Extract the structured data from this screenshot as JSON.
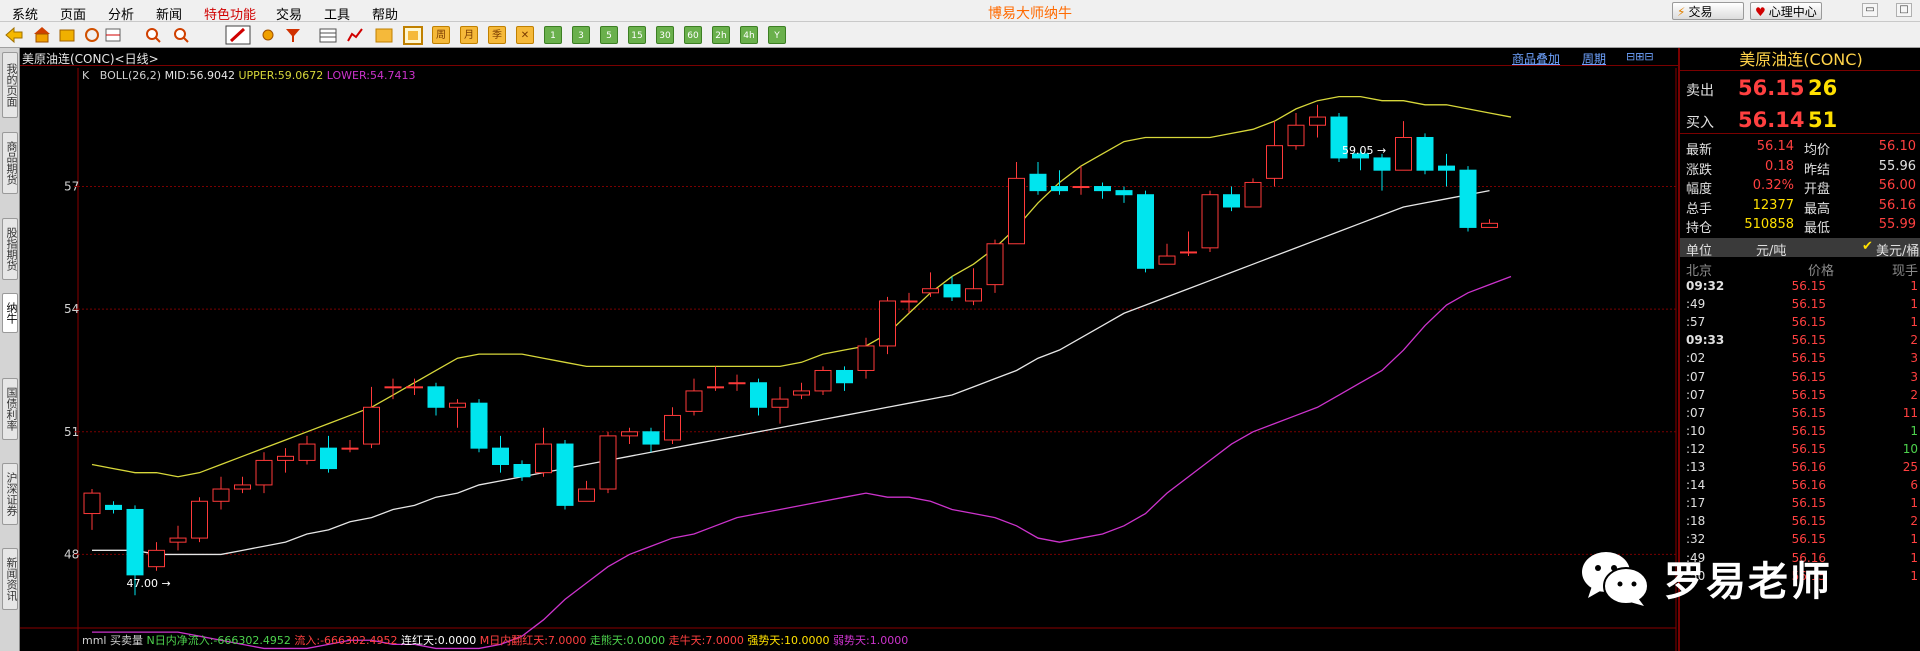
{
  "menu": [
    "系统",
    "页面",
    "分析",
    "新闻",
    "特色功能",
    "交易",
    "工具",
    "帮助"
  ],
  "app_title": "博易大师纳牛",
  "top_buttons": {
    "trade": "交易",
    "center": "心理中心"
  },
  "toolbar_labels": [
    "周",
    "月",
    "季",
    "1",
    "3",
    "5",
    "15",
    "30",
    "60",
    "2h",
    "4h",
    "Y"
  ],
  "left_tabs": [
    "我的页面",
    "商品期货",
    "股指期货",
    "纳牛",
    "国债利率",
    "沪深证券",
    "新闻资讯"
  ],
  "chart_header": {
    "title": "美原油连(CONC)<日线>",
    "link_add": "商品叠加",
    "link_period": "周期"
  },
  "indicator": {
    "prefix": "K",
    "name": "BOLL(26,2)",
    "mid": "MID:56.9042",
    "upper": "UPPER:59.0672",
    "lower": "LOWER:54.7413",
    "colors": {
      "mid": "#e6e6e6",
      "upper": "#d7d73a",
      "lower": "#cc33cc"
    }
  },
  "chart_data": {
    "type": "candlestick",
    "y_ticks": [
      48,
      51,
      54,
      57
    ],
    "ylim": [
      46.2,
      59.9
    ],
    "annotations": [
      {
        "text": "59.05",
        "index": 60
      },
      {
        "text": "47.00",
        "index": 3
      }
    ],
    "candles": [
      [
        49.0,
        49.5,
        49.6,
        48.6
      ],
      [
        49.2,
        49.1,
        49.3,
        49.0
      ],
      [
        49.1,
        47.5,
        49.2,
        47.0
      ],
      [
        47.7,
        48.1,
        48.3,
        47.6
      ],
      [
        48.3,
        48.4,
        48.7,
        48.1
      ],
      [
        48.4,
        49.3,
        49.4,
        48.3
      ],
      [
        49.3,
        49.6,
        49.9,
        49.1
      ],
      [
        49.6,
        49.7,
        49.9,
        49.5
      ],
      [
        49.7,
        50.3,
        50.5,
        49.5
      ],
      [
        50.3,
        50.4,
        50.6,
        50.0
      ],
      [
        50.3,
        50.7,
        50.9,
        50.2
      ],
      [
        50.6,
        50.1,
        50.9,
        50.0
      ],
      [
        50.6,
        50.6,
        50.8,
        50.5
      ],
      [
        50.7,
        51.6,
        52.1,
        50.6
      ],
      [
        52.1,
        52.1,
        52.3,
        51.8
      ],
      [
        52.1,
        52.1,
        52.3,
        51.9
      ],
      [
        52.1,
        51.6,
        52.2,
        51.4
      ],
      [
        51.6,
        51.7,
        51.8,
        51.1
      ],
      [
        51.7,
        50.6,
        51.8,
        50.5
      ],
      [
        50.6,
        50.2,
        50.9,
        50.0
      ],
      [
        50.2,
        49.9,
        50.3,
        49.8
      ],
      [
        50.0,
        50.7,
        51.1,
        49.9
      ],
      [
        50.7,
        49.2,
        50.8,
        49.1
      ],
      [
        49.3,
        49.6,
        49.8,
        49.3
      ],
      [
        49.6,
        50.9,
        51.0,
        49.5
      ],
      [
        50.9,
        51.0,
        51.1,
        50.7
      ],
      [
        51.0,
        50.7,
        51.1,
        50.5
      ],
      [
        50.8,
        51.4,
        51.6,
        50.7
      ],
      [
        51.5,
        52.0,
        52.3,
        51.4
      ],
      [
        52.1,
        52.1,
        52.6,
        52.0
      ],
      [
        52.2,
        52.2,
        52.4,
        52.0
      ],
      [
        52.2,
        51.6,
        52.3,
        51.4
      ],
      [
        51.6,
        51.8,
        52.1,
        51.2
      ],
      [
        51.9,
        52.0,
        52.2,
        51.8
      ],
      [
        52.0,
        52.5,
        52.6,
        51.9
      ],
      [
        52.5,
        52.2,
        52.6,
        52.0
      ],
      [
        52.5,
        53.1,
        53.3,
        52.3
      ],
      [
        53.1,
        54.2,
        54.3,
        52.9
      ],
      [
        54.2,
        54.2,
        54.4,
        53.9
      ],
      [
        54.4,
        54.5,
        54.9,
        54.3
      ],
      [
        54.6,
        54.3,
        54.8,
        54.2
      ],
      [
        54.2,
        54.5,
        55.0,
        54.1
      ],
      [
        54.6,
        55.6,
        55.7,
        54.4
      ],
      [
        55.6,
        57.2,
        57.6,
        55.6
      ],
      [
        57.3,
        56.9,
        57.6,
        56.8
      ],
      [
        57.0,
        56.9,
        57.4,
        56.8
      ],
      [
        57.0,
        57.0,
        57.5,
        56.8
      ],
      [
        57.0,
        56.9,
        57.1,
        56.7
      ],
      [
        56.9,
        56.8,
        57.0,
        56.6
      ],
      [
        56.8,
        55.0,
        56.9,
        54.9
      ],
      [
        55.1,
        55.3,
        55.6,
        55.1
      ],
      [
        55.4,
        55.4,
        55.9,
        55.3
      ],
      [
        55.5,
        56.8,
        56.9,
        55.4
      ],
      [
        56.8,
        56.5,
        57.0,
        56.4
      ],
      [
        56.5,
        57.1,
        57.2,
        56.5
      ],
      [
        57.2,
        58.0,
        58.6,
        57.0
      ],
      [
        58.0,
        58.5,
        58.8,
        57.9
      ],
      [
        58.5,
        58.7,
        59.0,
        58.2
      ],
      [
        58.7,
        57.7,
        58.8,
        57.6
      ],
      [
        57.8,
        57.7,
        57.9,
        57.4
      ],
      [
        57.7,
        57.4,
        57.8,
        56.9
      ],
      [
        57.4,
        58.2,
        58.6,
        57.4
      ],
      [
        58.2,
        57.4,
        58.3,
        57.3
      ],
      [
        57.5,
        57.4,
        57.8,
        57.0
      ],
      [
        57.4,
        56.0,
        57.5,
        55.9
      ],
      [
        56.0,
        56.1,
        56.2,
        56.0
      ]
    ],
    "series": [
      {
        "name": "UPPER",
        "values": [
          50.2,
          50.1,
          50.0,
          50.0,
          49.9,
          50.0,
          50.2,
          50.4,
          50.6,
          50.8,
          51.0,
          51.2,
          51.4,
          51.6,
          51.9,
          52.2,
          52.5,
          52.8,
          52.9,
          52.9,
          52.9,
          52.8,
          52.7,
          52.6,
          52.6,
          52.6,
          52.6,
          52.6,
          52.6,
          52.6,
          52.6,
          52.6,
          52.6,
          52.7,
          52.9,
          53.0,
          53.1,
          53.4,
          53.9,
          54.4,
          54.8,
          55.1,
          55.5,
          56.0,
          56.6,
          57.1,
          57.5,
          57.8,
          58.1,
          58.2,
          58.2,
          58.2,
          58.2,
          58.3,
          58.4,
          58.6,
          58.9,
          59.1,
          59.2,
          59.2,
          59.1,
          59.1,
          59.0,
          59.0,
          58.9,
          58.8,
          58.7
        ]
      },
      {
        "name": "MID",
        "values": [
          48.1,
          48.1,
          48.1,
          48.0,
          48.0,
          48.0,
          48.0,
          48.1,
          48.2,
          48.3,
          48.5,
          48.6,
          48.8,
          48.9,
          49.1,
          49.2,
          49.4,
          49.5,
          49.7,
          49.8,
          49.9,
          50.0,
          50.1,
          50.2,
          50.3,
          50.4,
          50.5,
          50.6,
          50.7,
          50.8,
          50.9,
          51.0,
          51.1,
          51.2,
          51.3,
          51.4,
          51.5,
          51.6,
          51.7,
          51.8,
          51.9,
          52.1,
          52.3,
          52.5,
          52.8,
          53.0,
          53.3,
          53.6,
          53.9,
          54.1,
          54.3,
          54.5,
          54.7,
          54.9,
          55.1,
          55.3,
          55.5,
          55.7,
          55.9,
          56.1,
          56.3,
          56.5,
          56.6,
          56.7,
          56.8,
          56.9
        ]
      },
      {
        "name": "LOWER",
        "values": [
          46.1,
          46.1,
          46.1,
          46.1,
          46.1,
          46.0,
          45.9,
          45.8,
          45.7,
          45.7,
          45.7,
          45.8,
          45.9,
          45.9,
          45.8,
          45.8,
          45.7,
          45.7,
          45.7,
          45.8,
          46.0,
          46.4,
          46.9,
          47.3,
          47.7,
          48.0,
          48.2,
          48.4,
          48.5,
          48.7,
          48.9,
          49.0,
          49.1,
          49.2,
          49.3,
          49.4,
          49.5,
          49.4,
          49.4,
          49.3,
          49.1,
          49.0,
          48.9,
          48.7,
          48.4,
          48.3,
          48.4,
          48.5,
          48.7,
          49.0,
          49.5,
          49.9,
          50.3,
          50.7,
          51.0,
          51.2,
          51.4,
          51.6,
          51.9,
          52.2,
          52.5,
          53.0,
          53.6,
          54.1,
          54.4,
          54.6,
          54.8
        ]
      }
    ]
  },
  "bottom_indicator": [
    {
      "text": "mml 买卖量",
      "color": "#d0d0d0"
    },
    {
      "text": "N日内净流入:-666302.4952",
      "color": "#4dd24d"
    },
    {
      "text": "流入:-666302.4952",
      "color": "#ff4040"
    },
    {
      "text": "连红天:0.0000",
      "color": "#ffffff"
    },
    {
      "text": "M日内翻红天:7.0000",
      "color": "#ff4040"
    },
    {
      "text": "走熊天:0.0000",
      "color": "#4dd24d"
    },
    {
      "text": "走牛天:7.0000",
      "color": "#ff4040"
    },
    {
      "text": "强势天:10.0000",
      "color": "#ffe000"
    },
    {
      "text": "弱势天:1.0000",
      "color": "#cc33cc"
    }
  ],
  "quote": {
    "title": "美原油连(CONC)",
    "sell": {
      "label": "卖出",
      "price": "56.15",
      "vol": "26"
    },
    "buy": {
      "label": "买入",
      "price": "56.14",
      "vol": "51"
    },
    "rows": [
      {
        "l1": "最新",
        "v1": "56.14",
        "c1": "#ff4040",
        "l2": "均价",
        "v2": "56.10",
        "c2": "#ff4040"
      },
      {
        "l1": "涨跌",
        "v1": "0.18",
        "c1": "#ff4040",
        "l2": "昨结",
        "v2": "55.96",
        "c2": "#e0e0e0"
      },
      {
        "l1": "幅度",
        "v1": "0.32%",
        "c1": "#ff4040",
        "l2": "开盘",
        "v2": "56.00",
        "c2": "#ff4040"
      },
      {
        "l1": "总手",
        "v1": "12377",
        "c1": "#ffe000",
        "l2": "最高",
        "v2": "56.16",
        "c2": "#ff4040"
      },
      {
        "l1": "持仓",
        "v1": "510858",
        "c1": "#ffe000",
        "l2": "最低",
        "v2": "55.99",
        "c2": "#ff4040"
      }
    ],
    "unit": {
      "label": "单位",
      "value": "元/吨",
      "alt": "美元/桶"
    },
    "tick_header": {
      "time": "北京",
      "price": "价格",
      "vol": "现手"
    },
    "ticks": [
      {
        "t": "09:32",
        "p": "56.15",
        "v": "1",
        "vc": "#ff4040"
      },
      {
        "t": ":49",
        "p": "56.15",
        "v": "1",
        "vc": "#ff4040"
      },
      {
        "t": ":57",
        "p": "56.15",
        "v": "1",
        "vc": "#ff4040"
      },
      {
        "t": "09:33",
        "p": "56.15",
        "v": "2",
        "vc": "#ff4040"
      },
      {
        "t": ":02",
        "p": "56.15",
        "v": "3",
        "vc": "#ff4040"
      },
      {
        "t": ":07",
        "p": "56.15",
        "v": "3",
        "vc": "#ff4040"
      },
      {
        "t": ":07",
        "p": "56.15",
        "v": "2",
        "vc": "#ff4040"
      },
      {
        "t": ":07",
        "p": "56.15",
        "v": "11",
        "vc": "#ff4040"
      },
      {
        "t": ":10",
        "p": "56.15",
        "v": "1",
        "vc": "#4dd24d"
      },
      {
        "t": ":12",
        "p": "56.15",
        "v": "10",
        "vc": "#4dd24d"
      },
      {
        "t": ":13",
        "p": "56.16",
        "v": "25",
        "vc": "#ff4040"
      },
      {
        "t": ":14",
        "p": "56.16",
        "v": "6",
        "vc": "#ff4040"
      },
      {
        "t": ":17",
        "p": "56.15",
        "v": "1",
        "vc": "#ff4040"
      },
      {
        "t": ":18",
        "p": "56.15",
        "v": "2",
        "vc": "#ff4040"
      },
      {
        "t": ":32",
        "p": "56.15",
        "v": "1",
        "vc": "#ff4040"
      },
      {
        "t": ":49",
        "p": "56.16",
        "v": "1",
        "vc": "#ff4040"
      },
      {
        "t": ":50",
        "p": "56.15",
        "v": "1",
        "vc": "#ff4040"
      }
    ]
  },
  "watermark": {
    "text": "罗易老师",
    "icon": "wechat-icon"
  },
  "colors": {
    "up": "#ff3a3a",
    "down": "#00e5ee",
    "grid": "#7a0000",
    "axis": "#8a0000"
  }
}
